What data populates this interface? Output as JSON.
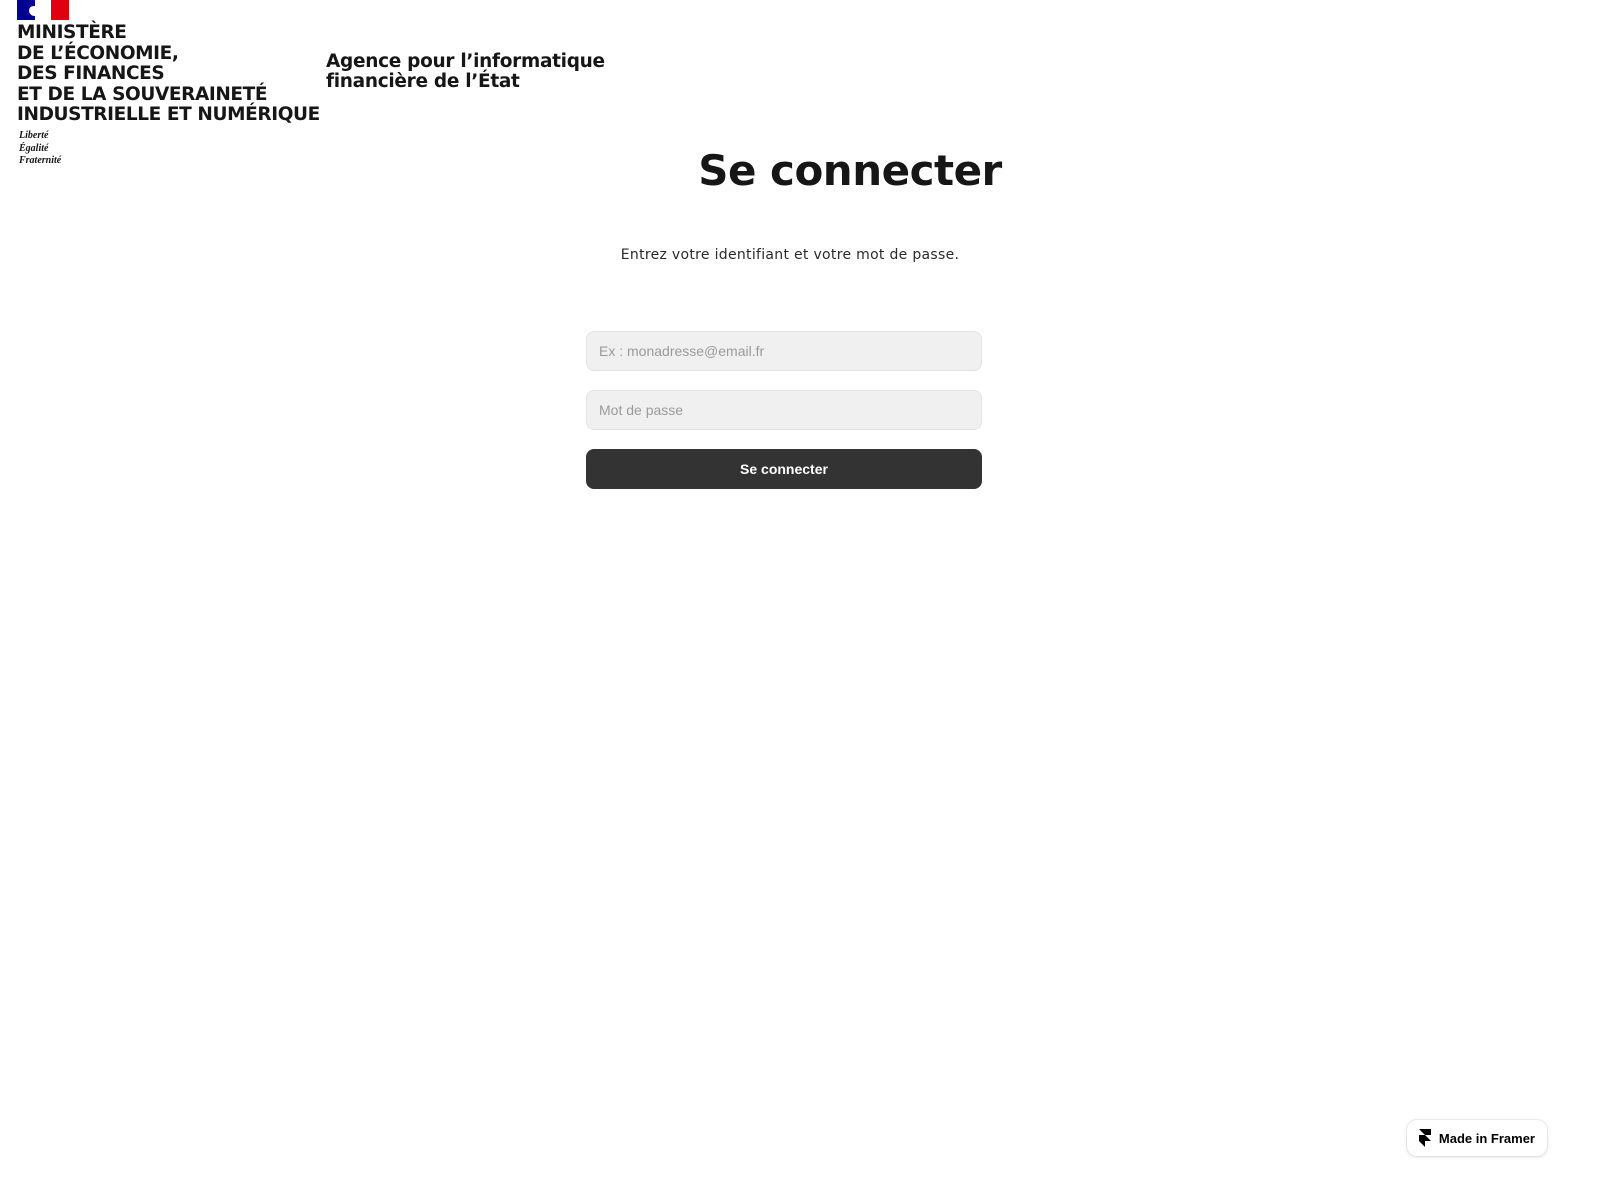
{
  "header": {
    "ministry_name": "MINISTÈRE\nDE L’ÉCONOMIE,\nDES FINANCES\nET DE LA SOUVERAINETÉ\nINDUSTRIELLE ET NUMÉRIQUE",
    "devise": "Liberté\nÉgalité\nFraternité",
    "agency_name": "Agence pour l’informatique\nfinancière de l’État",
    "flag_colors": [
      "#000091",
      "#ffffff",
      "#e1000f"
    ]
  },
  "login": {
    "title": "Se connecter",
    "subtitle": "Entrez votre identifiant et votre mot de passe.",
    "email_placeholder": "Ex : monadresse@email.fr",
    "email_value": "",
    "password_placeholder": "Mot de passe",
    "password_value": "",
    "submit_label": "Se connecter",
    "button_color": "#333333"
  },
  "badge": {
    "label": "Made in Framer",
    "icon": "framer-logo-icon"
  }
}
